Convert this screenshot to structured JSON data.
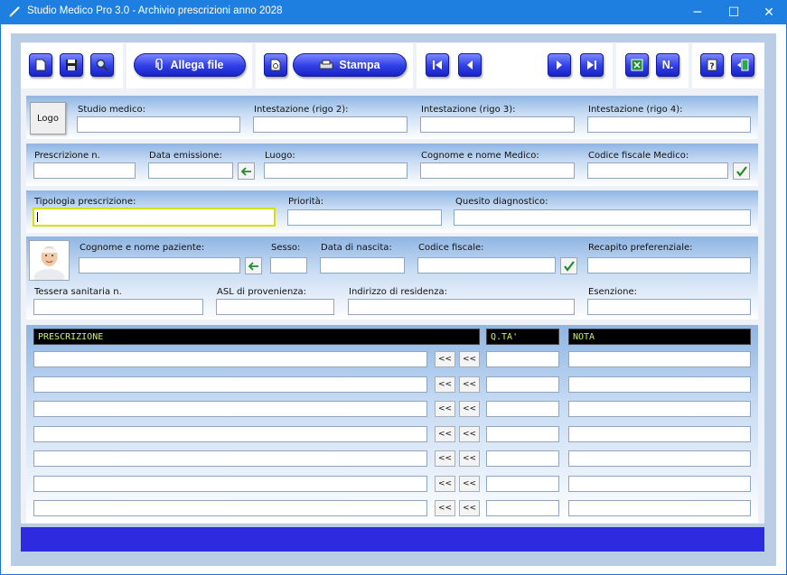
{
  "window": {
    "title": "Studio Medico Pro 3.0 - Archivio prescrizioni anno 2028",
    "minimize": "─",
    "maximize": "☐",
    "close": "✕"
  },
  "toolbar": {
    "allega_label": "Allega file",
    "stampa_label": "Stampa",
    "numerazione_label": "N."
  },
  "studio": {
    "logo_label": "Logo",
    "studio_medico_label": "Studio medico:",
    "intestazione2_label": "Intestazione (rigo 2):",
    "intestazione3_label": "Intestazione (rigo 3):",
    "intestazione4_label": "Intestazione (rigo 4):"
  },
  "prescrizione": {
    "numero_label": "Prescrizione n.",
    "data_label": "Data emissione:",
    "luogo_label": "Luogo:",
    "medico_label": "Cognome e nome Medico:",
    "cf_medico_label": "Codice fiscale Medico:"
  },
  "tipologia": {
    "tipologia_label": "Tipologia prescrizione:",
    "priorita_label": "Priorità:",
    "quesito_label": "Quesito diagnostico:"
  },
  "paziente": {
    "nome_label": "Cognome e nome paziente:",
    "sesso_label": "Sesso:",
    "nascita_label": "Data di nascita:",
    "cf_label": "Codice fiscale:",
    "recapito_label": "Recapito preferenziale:",
    "tessera_label": "Tessera sanitaria n.",
    "asl_label": "ASL di provenienza:",
    "indirizzo_label": "Indirizzo di residenza:",
    "esenzione_label": "Esenzione:"
  },
  "tabella": {
    "col_prescrizione": "PRESCRIZIONE",
    "col_qta": "Q.TA'",
    "col_nota": "NOTA",
    "arrow_label": "<<",
    "rows": 7
  }
}
